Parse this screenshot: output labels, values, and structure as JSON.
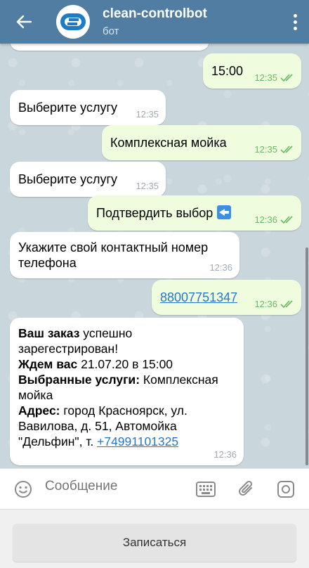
{
  "header": {
    "title": "clean-controlbot",
    "subtitle": "бот"
  },
  "messages": [
    {
      "time": "12:35",
      "text": "15:00"
    },
    {
      "time": "12:35",
      "text": "Выберите услугу"
    },
    {
      "time": "12:35",
      "text": "Комплексная мойка"
    },
    {
      "time": "12:35",
      "text": "Выберите услугу"
    },
    {
      "time": "12:36",
      "text": "Подтвердить выбор"
    },
    {
      "time": "12:36",
      "text": "Укажите свой контактный номер телефона"
    },
    {
      "time": "12:36",
      "text": "88007751347"
    },
    {
      "time": "12:36",
      "order_bold": "Ваш заказ",
      "order_text": " успешно зарегестрирован!",
      "wait_bold": "Ждем вас",
      "wait_text": " 21.07.20 в 15:00",
      "services_bold": "Выбранные услуги:",
      "services_text": " Комплексная мойка",
      "address_bold": "Адрес:",
      "address_text": " город Красноярск, ул. Вавилова, д. 51, Автомойка \"Дельфин\", т. ",
      "phone": "+74991101325"
    }
  ],
  "input": {
    "placeholder": "Сообщение"
  },
  "keyboard": {
    "button_label": "Записаться"
  },
  "colors": {
    "header": "#517da2",
    "outgoing": "#effdde",
    "incoming": "#ffffff",
    "check": "#6cb866",
    "link": "#2677c9"
  },
  "icons": [
    "back-arrow-icon",
    "bot-logo",
    "more-vertical-icon",
    "emoji-icon",
    "bot-keyboard-icon",
    "attach-icon",
    "camera-icon",
    "double-check-icon",
    "back-arrow-emoji-icon"
  ]
}
